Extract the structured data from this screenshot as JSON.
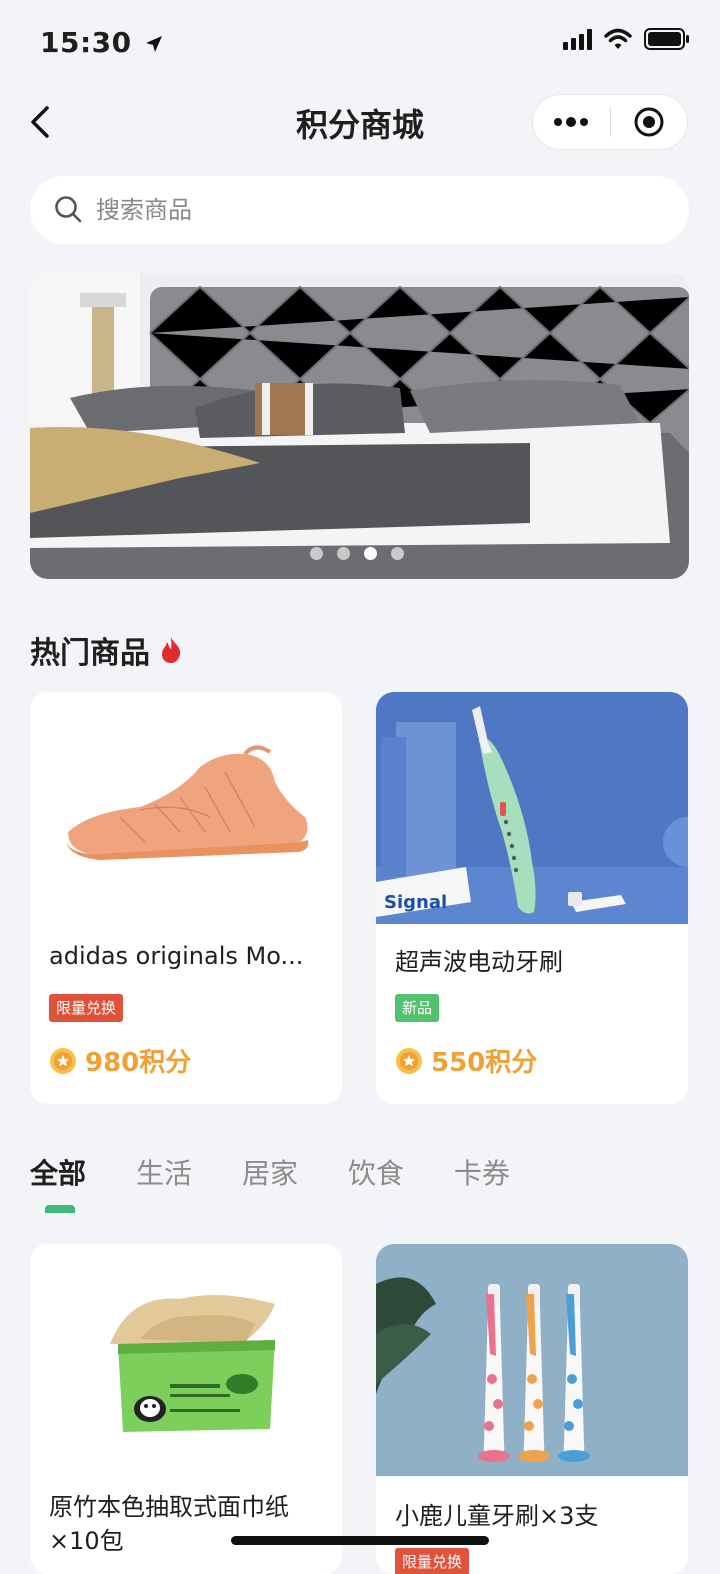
{
  "status_bar": {
    "time": "15:30"
  },
  "nav": {
    "title": "积分商城"
  },
  "search": {
    "placeholder": "搜索商品"
  },
  "banner": {
    "dot_count": 4,
    "active_dot": 3
  },
  "hot_section": {
    "title": "热门商品",
    "products": [
      {
        "name": "adidas originals Mo...",
        "badge": "限量兑换",
        "badge_color": "#e0533b",
        "price": "980积分"
      },
      {
        "name": "超声波电动牙刷",
        "badge": "新品",
        "badge_color": "#52c26e",
        "price": "550积分"
      }
    ]
  },
  "category_tabs": [
    {
      "label": "全部",
      "active": true
    },
    {
      "label": "生活",
      "active": false
    },
    {
      "label": "居家",
      "active": false
    },
    {
      "label": "饮食",
      "active": false
    },
    {
      "label": "卡券",
      "active": false
    }
  ],
  "list_products": [
    {
      "name": "原竹本色抽取式面巾纸×10包"
    },
    {
      "name": "小鹿儿童牙刷×3支",
      "badge": "限量兑换",
      "badge_color": "#e0533b"
    }
  ],
  "colors": {
    "accent_green": "#3eb87b",
    "price_orange": "#f0a035",
    "badge_red": "#e0533b",
    "badge_green": "#52c26e"
  }
}
